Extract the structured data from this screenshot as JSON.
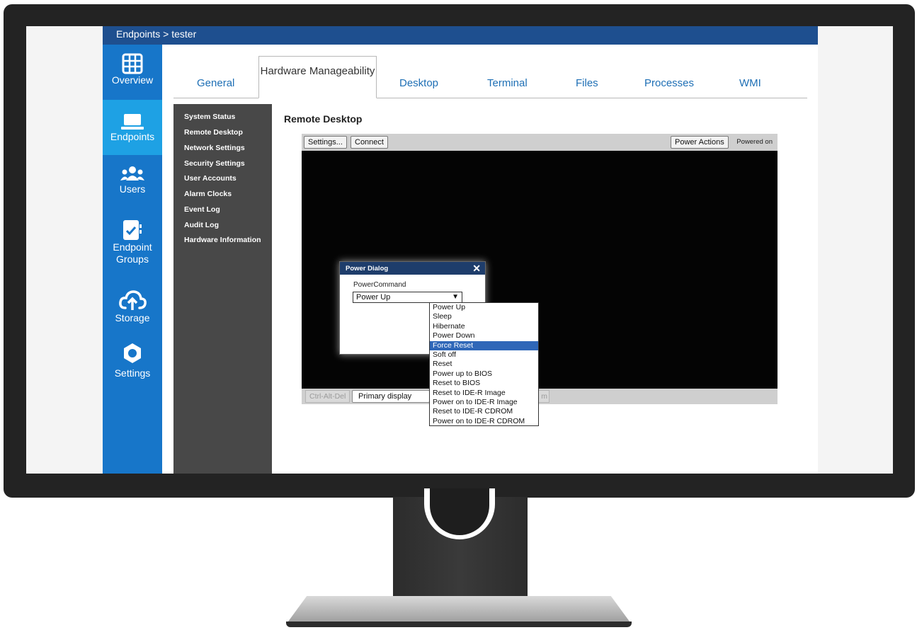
{
  "app": {
    "breadcrumb": "Endpoints > tester"
  },
  "leftnav": [
    {
      "label": "Overview",
      "icon": "grid-icon"
    },
    {
      "label": "Endpoints",
      "icon": "laptop-icon",
      "active": true
    },
    {
      "label": "Users",
      "icon": "users-icon"
    },
    {
      "label": "Endpoint Groups",
      "icon": "checklist-icon"
    },
    {
      "label": "Storage",
      "icon": "cloud-upload-icon"
    },
    {
      "label": "Settings",
      "icon": "gear-icon"
    }
  ],
  "tabs": [
    {
      "label": "General"
    },
    {
      "label": "Hardware Manageability",
      "active": true
    },
    {
      "label": "Desktop"
    },
    {
      "label": "Terminal"
    },
    {
      "label": "Files"
    },
    {
      "label": "Processes"
    },
    {
      "label": "WMI"
    }
  ],
  "subnav": [
    "System Status",
    "Remote Desktop",
    "Network Settings",
    "Security Settings",
    "User Accounts",
    "Alarm Clocks",
    "Event Log",
    "Audit Log",
    "Hardware Information"
  ],
  "remote_desktop": {
    "title": "Remote Desktop",
    "settings_button": "Settings...",
    "connect_button": "Connect",
    "power_actions_button": "Power Actions",
    "status": "Powered on",
    "ctrl_alt_del_button": "Ctrl-Alt-Del",
    "display_select": "Primary display",
    "bottom_partial": "m"
  },
  "power_dialog": {
    "title": "Power Dialog",
    "close": "✕",
    "command_label": "PowerCommand",
    "selected_value": "Power Up",
    "options": [
      "Power Up",
      "Sleep",
      "Hibernate",
      "Power Down",
      "Force Reset",
      "Soft off",
      "Reset",
      "Power up to BIOS",
      "Reset to BIOS",
      "Reset to IDE-R Image",
      "Power on to IDE-R Image",
      "Reset to IDE-R CDROM",
      "Power on to IDE-R CDROM"
    ],
    "highlighted_option": "Force Reset"
  },
  "colors": {
    "topbar": "#1e4f8f",
    "leftnav": "#1776c9",
    "leftnav_active": "#1ea1e4",
    "tab_link": "#1e6fb5",
    "subnav": "#484848",
    "dialog_header": "#1e3d6b",
    "dropdown_highlight": "#2f67b8"
  }
}
